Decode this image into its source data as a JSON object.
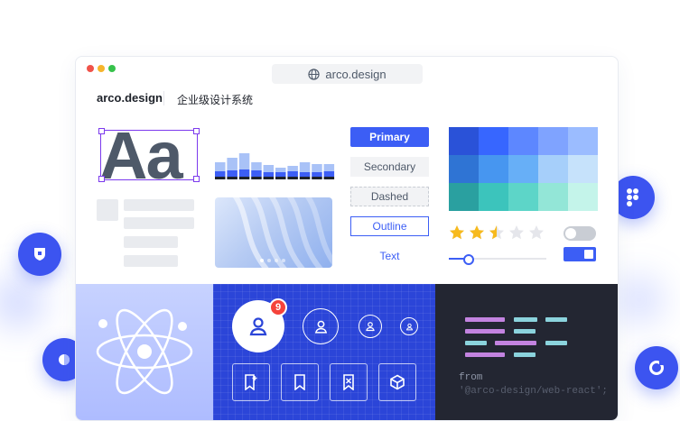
{
  "browser": {
    "url": "arco.design"
  },
  "header": {
    "brand": "arco.design",
    "subtitle": "企业级设计系统"
  },
  "typography": {
    "sample": "Aa"
  },
  "buttons": {
    "primary": "Primary",
    "secondary": "Secondary",
    "dashed": "Dashed",
    "outline": "Outline",
    "text": "Text"
  },
  "bar_chart": {
    "series_colors": [
      "#1d2129",
      "#3c5ef5",
      "#a9c2f7"
    ],
    "stacks": [
      [
        3,
        6,
        10
      ],
      [
        3,
        7,
        14
      ],
      [
        3,
        8,
        18
      ],
      [
        3,
        7,
        9
      ],
      [
        3,
        5,
        8
      ],
      [
        3,
        5,
        5
      ],
      [
        3,
        6,
        6
      ],
      [
        3,
        5,
        11
      ],
      [
        3,
        5,
        9
      ],
      [
        3,
        6,
        8
      ]
    ]
  },
  "palette": {
    "rows": [
      [
        "#2a52d8",
        "#3766ff",
        "#5d87ff",
        "#7fa3ff",
        "#9bbcff"
      ],
      [
        "#2f74d4",
        "#4796f0",
        "#67aff7",
        "#a6cffa",
        "#c6e2fb"
      ],
      [
        "#2aa0a0",
        "#3cc4bc",
        "#5dd5c8",
        "#93e6d7",
        "#c4f4ea"
      ]
    ]
  },
  "rating": {
    "value": 2.5,
    "max": 5,
    "filled_color": "#f7ba1e",
    "empty_color": "#e5e6eb"
  },
  "slider": {
    "value": 0.2
  },
  "switches": [
    {
      "state": "off"
    },
    {
      "state": "on"
    }
  ],
  "avatars": {
    "badge_count": "9"
  },
  "code": {
    "from_keyword": "from",
    "module": "'@arco-design/web-react';"
  },
  "colors": {
    "accent": "#165dff",
    "blue_panel": "#2b45d8",
    "dark_panel": "#232632"
  }
}
